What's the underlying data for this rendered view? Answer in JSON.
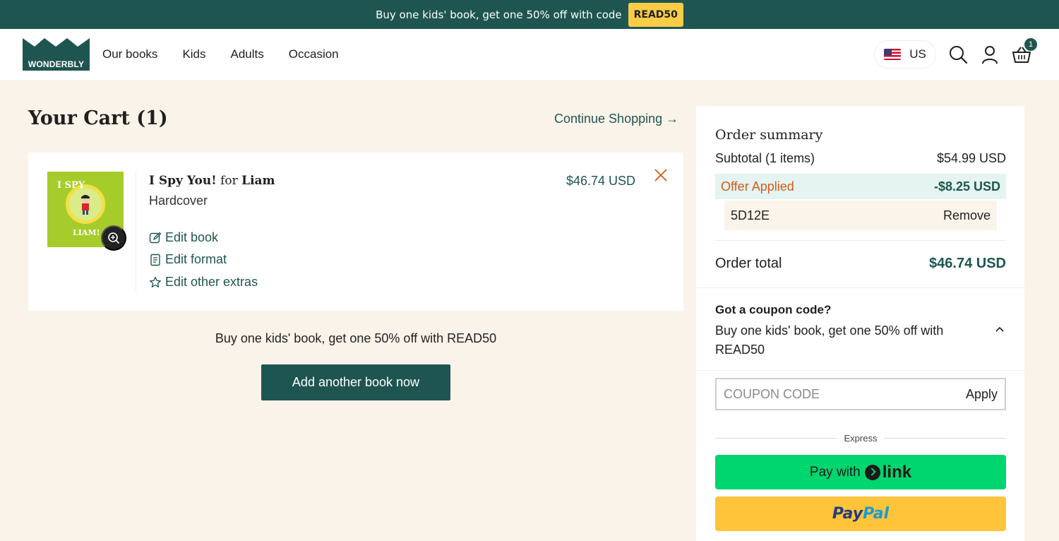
{
  "promo": {
    "text": "Buy one kids' book, get one 50% off with code",
    "code": "READ50"
  },
  "header": {
    "logo_text": "WONDERBLY",
    "nav": [
      "Our books",
      "Kids",
      "Adults",
      "Occasion"
    ],
    "region": "US",
    "cart_count": "1"
  },
  "cart": {
    "title": "Your Cart (1)",
    "continue_label": "Continue Shopping →",
    "item": {
      "title_prefix": "I Spy You!",
      "title_for": "for",
      "title_name": "Liam",
      "format": "Hardcover",
      "price": "$46.74 USD",
      "cover_title": "I SPY",
      "cover_name": "LIAM!",
      "actions": {
        "edit_book": "Edit book",
        "edit_format": "Edit format",
        "edit_extras": "Edit other extras"
      }
    },
    "promo_line": "Buy one kids' book, get one 50% off with READ50",
    "add_button": "Add another book now"
  },
  "summary": {
    "title": "Order summary",
    "subtotal_label": "Subtotal (1 items)",
    "subtotal_value": "$54.99 USD",
    "offer_label": "Offer Applied",
    "offer_value": "-$8.25 USD",
    "code": "5D12E",
    "remove_label": "Remove",
    "total_label": "Order total",
    "total_value": "$46.74 USD",
    "coupon_question": "Got a coupon code?",
    "coupon_desc": "Buy one kids' book, get one 50% off with READ50",
    "coupon_placeholder": "COUPON CODE",
    "apply_label": "Apply",
    "express_label": "Express",
    "pay_with": "Pay with",
    "link_text": "link",
    "paypal_1": "Pay",
    "paypal_2": "Pal"
  },
  "colors": {
    "brand": "#1f5551",
    "background": "#faf3e9",
    "accent": "#fbcc45",
    "offer": "#d35b1a",
    "link_green": "#00d66f",
    "paypal": "#ffc439"
  }
}
